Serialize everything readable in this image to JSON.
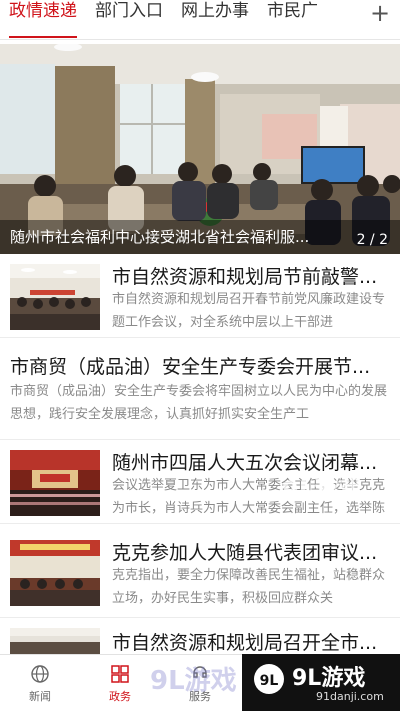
{
  "tabs": [
    {
      "label": "政情速递",
      "active": true
    },
    {
      "label": "部门入口",
      "active": false
    },
    {
      "label": "网上办事",
      "active": false
    },
    {
      "label": "市民广",
      "active": false
    }
  ],
  "tab_add_icon": "plus-icon",
  "banner": {
    "caption": "随州市社会福利中心接受湖北省社会福利服...",
    "pager": "2 / 2"
  },
  "news": [
    {
      "title": "市自然资源和规划局节前敲警...",
      "summary": "市自然资源和规划局召开春节前党风廉政建设专题工作会议，对全系统中层以上干部进",
      "has_thumb": true
    },
    {
      "title": "市商贸（成品油）安全生产专委会开展节...",
      "summary": "市商贸（成品油）安全生产专委会将牢固树立以人民为中心的发展思想，践行安全发展理念，认真抓好抓实安全生产工",
      "has_thumb": false
    },
    {
      "title": "随州市四届人大五次会议闭幕...",
      "summary": "会议选举夏卫东为市人大常委会主任，选举克克为市长，肖诗兵为市人大常委会副主任，选举陈",
      "has_thumb": true
    },
    {
      "title": "克克参加人大随县代表团审议...",
      "summary": "克克指出，要全力保障改善民生福祉，站稳群众立场，办好民生实事，积极回应群众关",
      "has_thumb": true
    },
    {
      "title": "市自然资源和规划局召开全市...",
      "summary": "",
      "has_thumb": true
    }
  ],
  "bottom_nav": [
    {
      "label": "新闻",
      "icon": "globe-icon",
      "active": false
    },
    {
      "label": "政务",
      "icon": "grid-icon",
      "active": true
    },
    {
      "label": "服务",
      "icon": "service-icon",
      "active": false
    }
  ],
  "watermark": {
    "brand": "9L游戏",
    "site": "91danji.com",
    "text_overlay": "9L游戏"
  },
  "colors": {
    "accent": "#d0141b",
    "caption_bg": "rgba(0,0,0,0.45)"
  }
}
